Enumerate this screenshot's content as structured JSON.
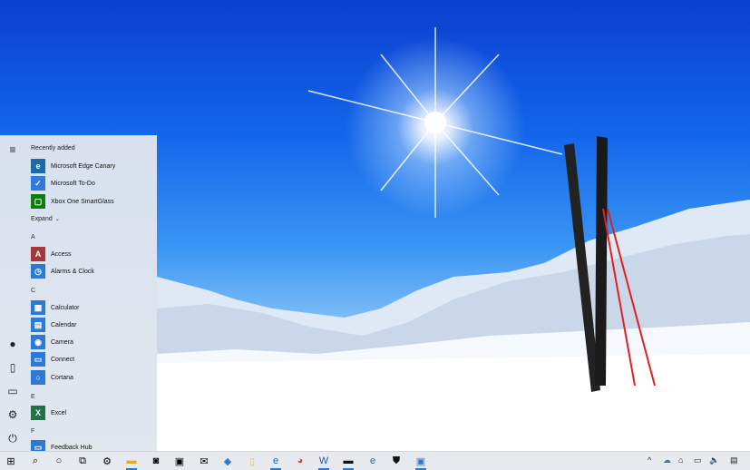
{
  "start_menu": {
    "recently_added_label": "Recently added",
    "recent_apps": [
      {
        "label": "Microsoft Edge Canary",
        "tile_color": "#1e6aa8",
        "icon": "edge-canary-icon"
      },
      {
        "label": "Microsoft To-Do",
        "tile_color": "#2f7be0",
        "icon": "checkmark-icon"
      },
      {
        "label": "Xbox One SmartGlass",
        "tile_color": "#107c10",
        "icon": "xbox-smartglass-icon"
      }
    ],
    "expand_label": "Expand",
    "groups": [
      {
        "letter": "A",
        "apps": [
          {
            "label": "Access",
            "tile_color": "#a4373a",
            "glyph": "A"
          },
          {
            "label": "Alarms & Clock",
            "tile_color": "#2b7bd6",
            "glyph": ""
          }
        ]
      },
      {
        "letter": "C",
        "apps": [
          {
            "label": "Calculator",
            "tile_color": "#2b7bd6",
            "glyph": ""
          },
          {
            "label": "Calendar",
            "tile_color": "#2b7bd6",
            "glyph": ""
          },
          {
            "label": "Camera",
            "tile_color": "#2b7bd6",
            "glyph": ""
          },
          {
            "label": "Connect",
            "tile_color": "#2b7bd6",
            "glyph": ""
          },
          {
            "label": "Cortana",
            "tile_color": "#2b7bd6",
            "glyph": ""
          }
        ]
      },
      {
        "letter": "E",
        "apps": [
          {
            "label": "Excel",
            "tile_color": "#217346",
            "glyph": "X"
          }
        ]
      },
      {
        "letter": "F",
        "apps": [
          {
            "label": "Feedback Hub",
            "tile_color": "#2b7bd6",
            "glyph": ""
          }
        ]
      }
    ]
  },
  "taskbar": {
    "pinned": [
      "start-icon",
      "search-icon",
      "cortana-icon",
      "task-view-icon",
      "settings-icon",
      "file-explorer-icon",
      "camera-icon",
      "store-icon",
      "mail-icon",
      "app-icon",
      "notepad-icon",
      "edge-canary-icon",
      "chrome-icon",
      "word-icon",
      "terminal-icon",
      "edge-beta-icon",
      "security-icon",
      "remote-desktop-icon"
    ],
    "tray": [
      "chevron-up-icon",
      "onedrive-icon",
      "network-icon",
      "display-icon",
      "volume-icon",
      "notification-icon"
    ]
  }
}
